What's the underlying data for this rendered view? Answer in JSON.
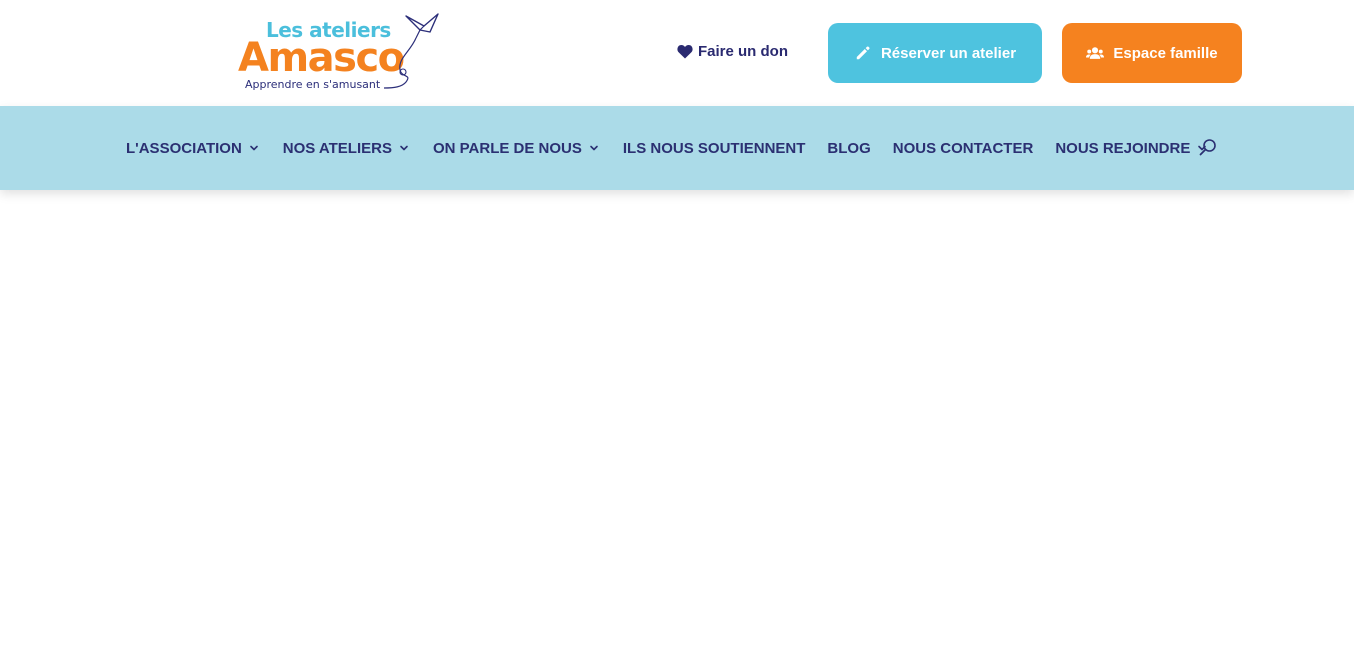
{
  "logo": {
    "line1": "Les ateliers",
    "line2": "Amasco",
    "tagline": "Apprendre en s'amusant",
    "icon": "kite-bird-icon"
  },
  "header": {
    "donate_label": "Faire un don",
    "donate_icon": "heart-icon",
    "reserve_label": "Réserver un atelier",
    "reserve_icon": "pencil-icon",
    "family_label": "Espace famille",
    "family_icon": "users-icon"
  },
  "colors": {
    "brand_orange": "#f5821f",
    "brand_blue": "#4ec3df",
    "nav_background": "#abdbe8",
    "nav_text": "#2b3072"
  },
  "nav": {
    "items": [
      {
        "label": "L'ASSOCIATION",
        "has_dropdown": true
      },
      {
        "label": "NOS ATELIERS",
        "has_dropdown": true
      },
      {
        "label": "ON PARLE DE NOUS",
        "has_dropdown": true
      },
      {
        "label": "ILS NOUS SOUTIENNENT",
        "has_dropdown": false
      },
      {
        "label": "BLOG",
        "has_dropdown": false
      },
      {
        "label": "NOUS CONTACTER",
        "has_dropdown": false
      },
      {
        "label": "NOUS REJOINDRE",
        "has_dropdown": true
      }
    ],
    "search_icon": "search-icon"
  }
}
